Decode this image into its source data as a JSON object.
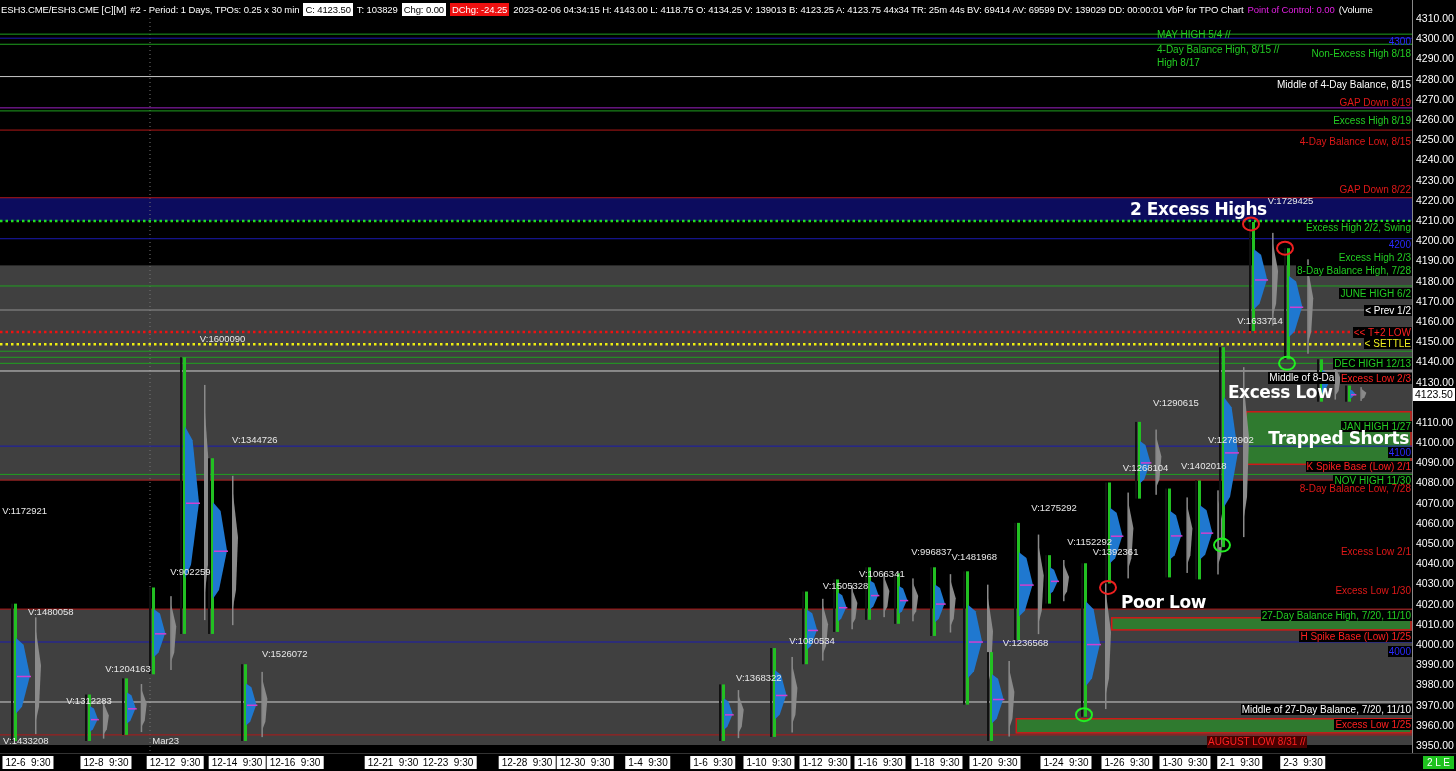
{
  "header": {
    "items": [
      {
        "text": "ESH3.CME/ESH3.CME [C][M]",
        "kind": "plain"
      },
      {
        "text": "#2 - Period: 1 Days, TPOs: 0.25 x 30 min",
        "kind": "plain"
      },
      {
        "text": "C: 4123.50",
        "kind": "boxed"
      },
      {
        "text": "T: 103829",
        "kind": "plain"
      },
      {
        "text": "Chg: 0.00",
        "kind": "boxed"
      },
      {
        "text": "DChg: -24.25",
        "kind": "alert"
      },
      {
        "text": "2023-02-06 04:34:15 H: 4143.00 L: 4118.75 O: 4134.25 V: 139013 B: 4123.25 A: 4123.75 44x34 TR: 25m 44s BV: 69414 AV: 69599 DV: 139029 DD: 00:00:01 VbP for TPO Chart",
        "kind": "plain"
      },
      {
        "text": "Point of Control: 0.00",
        "kind": "poc"
      },
      {
        "text": "(Volume",
        "kind": "plain"
      }
    ]
  },
  "chart": {
    "level_labels": [
      "4300",
      "Non-Excess High 8/18",
      "Middle of 4-Day Balance, 8/15",
      "GAP Down 8/19",
      "Excess High 8/19",
      "4-Day Balance Low, 8/15",
      "GAP Down 8/22",
      "Excess High 2/2, Swing",
      "4200",
      "Excess High 2/3",
      "8-Day Balance High, 7/28",
      "JUNE HIGH 6/2",
      "< Prev 1/2",
      "<< T+2 LOW",
      "< SETTLE",
      "DEC HIGH 12/13",
      "Excess Low 2/3",
      "JAN HIGH 1/27",
      "4100",
      "K Spike Base (Low) 2/1",
      "NOV HIGH 11/30",
      "8-Day Balance Low, 7/28",
      "Excess Low 2/1",
      "Excess Low 1/30",
      "27-Day Balance High, 7/20, 11/10",
      "H Spike Base (Low) 1/25",
      "4000",
      "Middle of 27-Day Balance, 7/20, 11/10",
      "Excess Low 1/25"
    ],
    "notes": [
      "MAY HIGH 5/4 //",
      "4-Day Balance High, 8/15 //",
      "High 8/17",
      "AUGUST LOW 8/31 //",
      "Middle of 8-Da"
    ],
    "callouts": [
      "2 Excess Highs",
      "Excess Low",
      "Trapped Shorts",
      "Poor Low"
    ],
    "volume_labels": [
      "V:1600090",
      "V:1344726",
      "V:1172921",
      "V:902259",
      "V:1480058",
      "V:1526072",
      "V:1204163",
      "V:1312283",
      "V:1433208",
      "Mar23",
      "V:1368322",
      "V:1080534",
      "V:1505328",
      "V:1066341",
      "V:996837",
      "V:1481968",
      "V:1236568",
      "V:1275292",
      "V:1152292",
      "V:1392361",
      "V:1268104",
      "V:1402018",
      "V:1278902",
      "V:1290615",
      "V:1633714",
      "V:1729425"
    ],
    "price_axis": [
      "4310.00",
      "4300.00",
      "4290.00",
      "4280.00",
      "4270.00",
      "4260.00",
      "4250.00",
      "4240.00",
      "4230.00",
      "4220.00",
      "4210.00",
      "4200.00",
      "4190.00",
      "4180.00",
      "4170.00",
      "4160.00",
      "4150.00",
      "4140.00",
      "4130.00",
      "4110.00",
      "4100.00",
      "4090.00",
      "4080.00",
      "4070.00",
      "4060.00",
      "4050.00",
      "4040.00",
      "4030.00",
      "4020.00",
      "4010.00",
      "4000.00",
      "3990.00",
      "3980.00",
      "3970.00",
      "3960.00",
      "3950.00"
    ],
    "last_price": "4123.50",
    "time_axis": [
      "12-6  9:30",
      "12-8  9:30",
      "12-12  9:30",
      "12-14  9:30",
      "12-16  9:30",
      "12-21  9:30",
      "12-23  9:30",
      "12-28  9:30",
      "12-30  9:30",
      "1-4  9:30",
      "1-6  9:30",
      "1-10  9:30",
      "1-12  9:30",
      "1-16  9:30",
      "1-18  9:30",
      "1-20  9:30",
      "1-24  9:30",
      "1-26  9:30",
      "1-30  9:30",
      "2-1  9:30",
      "2-3  9:30"
    ]
  },
  "status": {
    "badge": "2 L E"
  }
}
